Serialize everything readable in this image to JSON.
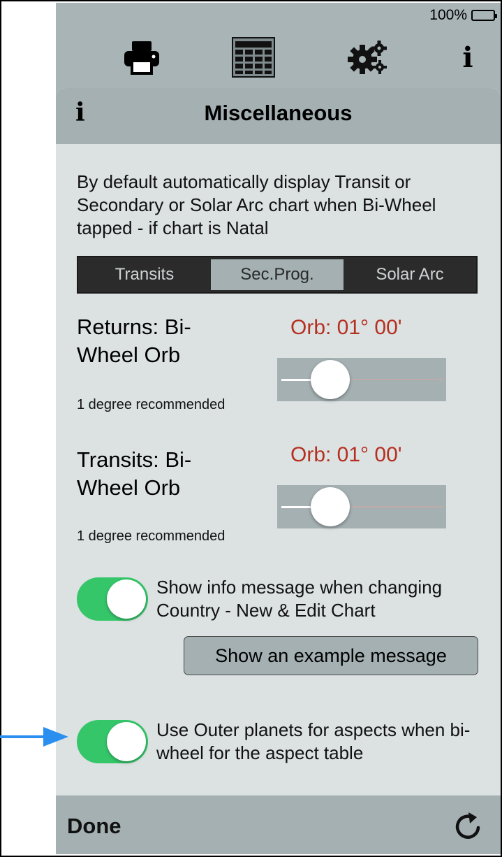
{
  "status_bar": {
    "battery_percent": "100%"
  },
  "toolbar": {
    "icons": [
      "printer-icon",
      "calendar-grid-icon",
      "gears-icon",
      "info-icon"
    ],
    "info_glyph": "i"
  },
  "popover": {
    "info_glyph": "i",
    "title": "Miscellaneous",
    "description": "By default automatically display Transit or Secondary or Solar Arc chart when Bi-Wheel tapped - if chart is Natal",
    "segments": [
      "Transits",
      "Sec.Prog.",
      "Solar Arc"
    ],
    "selected_segment": "Sec.Prog.",
    "returns": {
      "label": "Returns: Bi-Wheel Orb",
      "orb": "Orb: 01° 00'",
      "recommendation": "1 degree recommended",
      "slider_fraction": 0.25
    },
    "transits": {
      "label": "Transits: Bi-Wheel Orb",
      "orb": "Orb: 01° 00'",
      "recommendation": "1 degree recommended",
      "slider_fraction": 0.25
    },
    "toggle_info": {
      "label": "Show info message when changing Country - New & Edit Chart",
      "on": true
    },
    "example_button": "Show an example message",
    "toggle_outer": {
      "label": "Use Outer planets for aspects when bi-wheel for the aspect table",
      "on": true
    },
    "done_label": "Done"
  },
  "colors": {
    "orb_text": "#b53020",
    "toggle_on": "#35c66a",
    "annotation_arrow": "#2b8ff0"
  }
}
